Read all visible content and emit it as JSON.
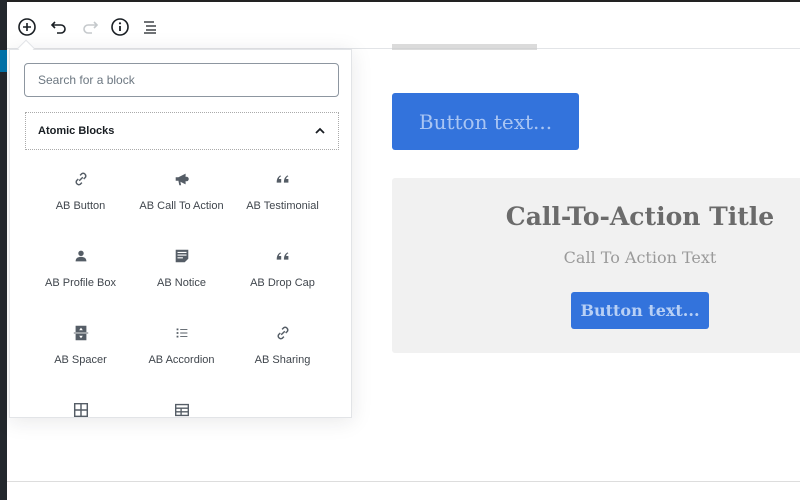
{
  "toolbar": {
    "items": [
      {
        "name": "add-block",
        "icon": "plus-circle-icon"
      },
      {
        "name": "undo",
        "icon": "undo-icon"
      },
      {
        "name": "redo",
        "icon": "redo-icon",
        "disabled": true
      },
      {
        "name": "info",
        "icon": "info-icon"
      },
      {
        "name": "outline",
        "icon": "list-outline-icon"
      }
    ]
  },
  "inserter": {
    "search_placeholder": "Search for a block",
    "panel_title": "Atomic Blocks",
    "panel_expanded": true,
    "blocks": [
      {
        "label": "AB Button",
        "icon": "link-icon"
      },
      {
        "label": "AB Call To Action",
        "icon": "megaphone-icon"
      },
      {
        "label": "AB Testimonial",
        "icon": "quote-icon"
      },
      {
        "label": "AB Profile Box",
        "icon": "person-icon"
      },
      {
        "label": "AB Notice",
        "icon": "notice-icon"
      },
      {
        "label": "AB Drop Cap",
        "icon": "quote-icon"
      },
      {
        "label": "AB Spacer",
        "icon": "spacer-icon"
      },
      {
        "label": "AB Accordion",
        "icon": "list-icon"
      },
      {
        "label": "AB Sharing",
        "icon": "link-icon"
      },
      {
        "icon": "grid-icon"
      },
      {
        "icon": "table-icon"
      }
    ]
  },
  "content": {
    "button_text": "Button text...",
    "cta_title": "Call-To-Action Title",
    "cta_text": "Call To Action Text",
    "cta_button_text": "Button text..."
  },
  "colors": {
    "accent": "#3373dc",
    "cta_bg": "#f1f1f1"
  }
}
